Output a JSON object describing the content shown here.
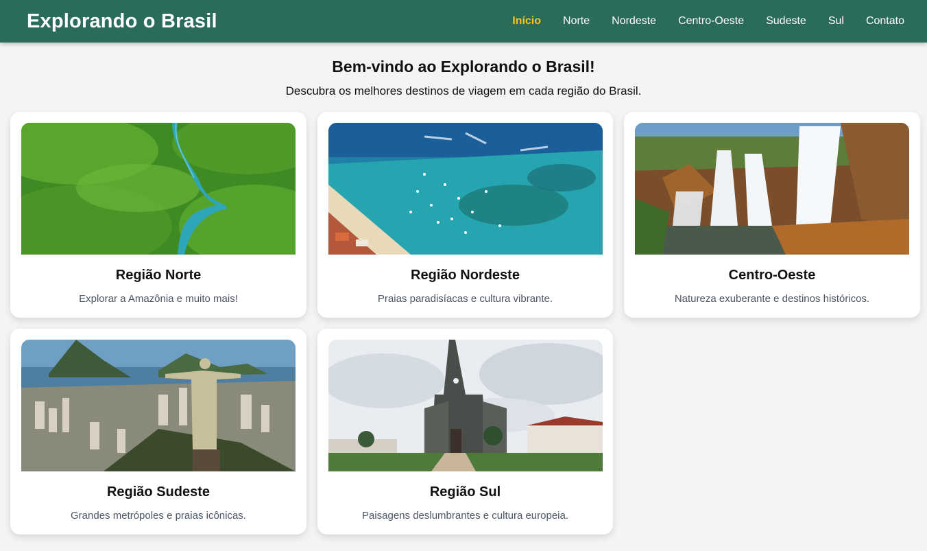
{
  "header": {
    "brand": "Explorando o Brasil",
    "nav": [
      "Início",
      "Norte",
      "Nordeste",
      "Centro-Oeste",
      "Sudeste",
      "Sul",
      "Contato"
    ],
    "active_index": 0
  },
  "hero": {
    "title": "Bem-vindo ao Explorando o Brasil!",
    "subtitle": "Descubra os melhores destinos de viagem em cada região do Brasil."
  },
  "cards": [
    {
      "title": "Região Norte",
      "description": "Explorar a Amazônia e muito mais!",
      "image": "amazon-rainforest-river-photo"
    },
    {
      "title": "Região Nordeste",
      "description": "Praias paradisíacas e cultura vibrante.",
      "image": "tropical-beach-boats-photo"
    },
    {
      "title": "Centro-Oeste",
      "description": "Natureza exuberante e destinos históricos.",
      "image": "waterfall-canyon-photo"
    },
    {
      "title": "Região Sudeste",
      "description": "Grandes metrópoles e praias icônicas.",
      "image": "christ-the-redeemer-rio-photo"
    },
    {
      "title": "Região Sul",
      "description": "Paisagens deslumbrantes e cultura europeia.",
      "image": "gothic-cathedral-town-photo"
    }
  ],
  "colors": {
    "header_bg": "#2a6b5b",
    "active_link": "#f5c518",
    "page_bg": "#f3f4f6",
    "card_bg": "#ffffff",
    "description_text": "#4b5563"
  }
}
